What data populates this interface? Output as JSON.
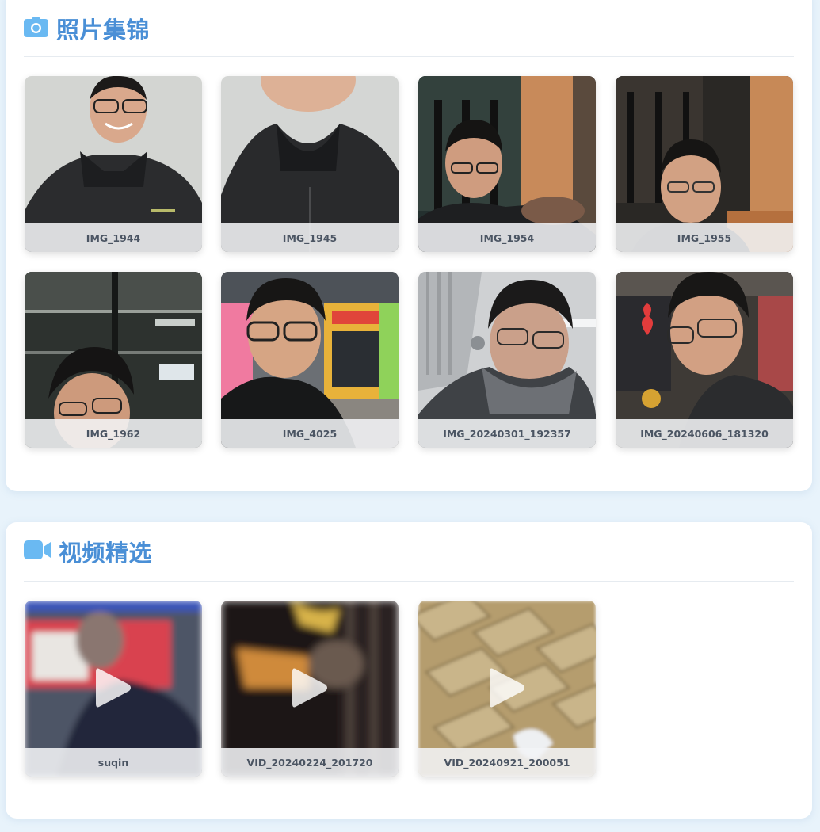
{
  "photos_section": {
    "title": "照片集锦",
    "icon": "camera-icon",
    "accent": "#4a8fd6",
    "items": [
      {
        "caption": "IMG_1944"
      },
      {
        "caption": "IMG_1945"
      },
      {
        "caption": "IMG_1954"
      },
      {
        "caption": "IMG_1955"
      },
      {
        "caption": "IMG_1962"
      },
      {
        "caption": "IMG_4025"
      },
      {
        "caption": "IMG_20240301_192357"
      },
      {
        "caption": "IMG_20240606_181320"
      }
    ]
  },
  "videos_section": {
    "title": "视频精选",
    "icon": "video-camera-icon",
    "items": [
      {
        "caption": "suqin",
        "icon": "play-icon"
      },
      {
        "caption": "VID_20240224_201720",
        "icon": "play-icon"
      },
      {
        "caption": "VID_20240921_200051",
        "icon": "play-icon"
      }
    ]
  }
}
